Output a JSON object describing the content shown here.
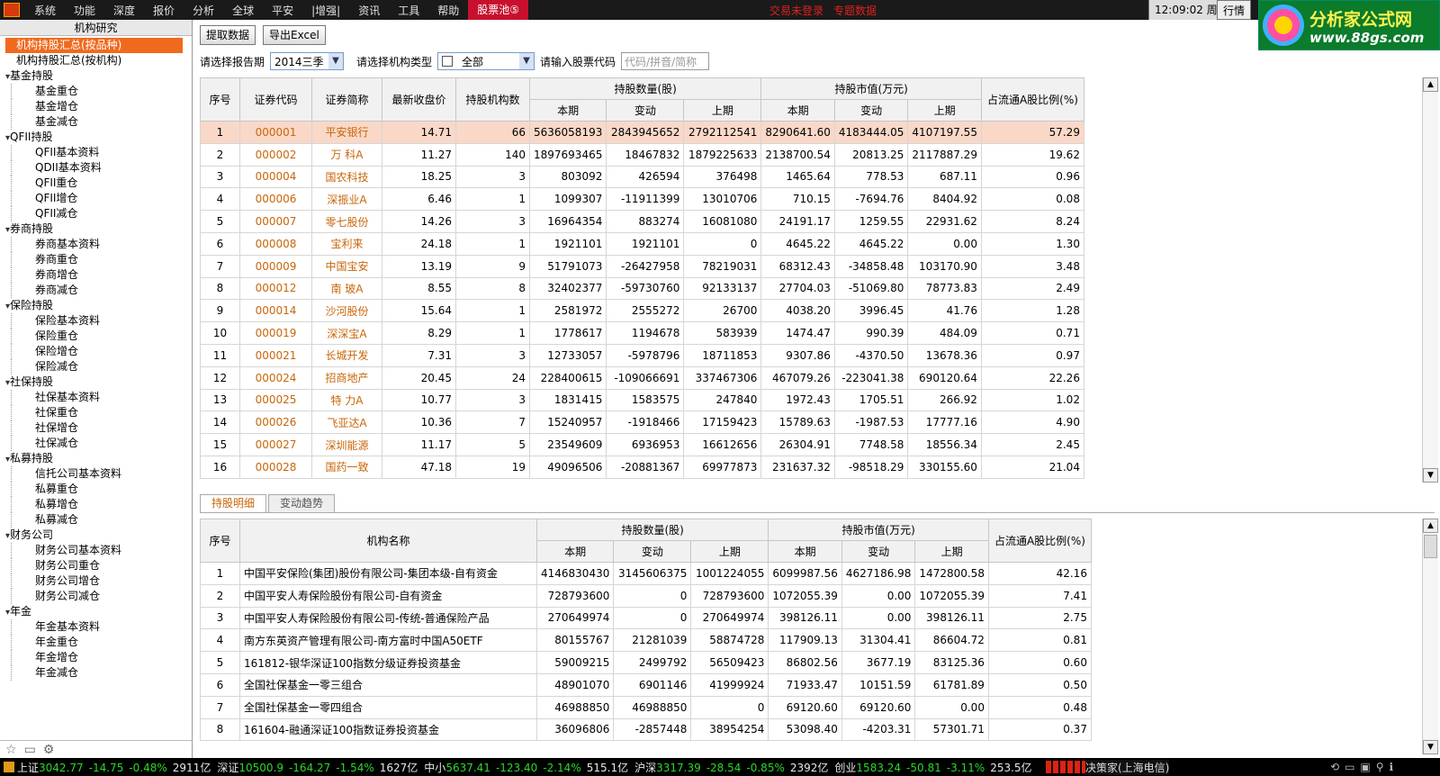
{
  "menu": {
    "items": [
      "系统",
      "功能",
      "深度",
      "报价",
      "分析",
      "全球",
      "平安",
      "|增强|",
      "资讯",
      "工具",
      "帮助"
    ],
    "active": "股票池⑤",
    "notice1": "交易未登录",
    "notice2": "专题数据",
    "clock": "12:09:02 周五",
    "hangqing": "行情"
  },
  "brand": {
    "title": "分析家公式网",
    "url": "www.88gs.com"
  },
  "sidebar": {
    "title": "机构研究",
    "items": [
      {
        "label": "机构持股汇总(按品种)",
        "type": "sel"
      },
      {
        "label": "机构持股汇总(按机构)",
        "type": "r"
      },
      {
        "label": "基金持股",
        "type": "g"
      },
      {
        "label": "基金重仓",
        "type": "c"
      },
      {
        "label": "基金增仓",
        "type": "c"
      },
      {
        "label": "基金减仓",
        "type": "c"
      },
      {
        "label": "QFII持股",
        "type": "g"
      },
      {
        "label": "QFII基本资料",
        "type": "c"
      },
      {
        "label": "QDII基本资料",
        "type": "c"
      },
      {
        "label": "QFII重仓",
        "type": "c"
      },
      {
        "label": "QFII增仓",
        "type": "c"
      },
      {
        "label": "QFII减仓",
        "type": "c"
      },
      {
        "label": "券商持股",
        "type": "g"
      },
      {
        "label": "券商基本资料",
        "type": "c"
      },
      {
        "label": "券商重仓",
        "type": "c"
      },
      {
        "label": "券商增仓",
        "type": "c"
      },
      {
        "label": "券商减仓",
        "type": "c"
      },
      {
        "label": "保险持股",
        "type": "g"
      },
      {
        "label": "保险基本资料",
        "type": "c"
      },
      {
        "label": "保险重仓",
        "type": "c"
      },
      {
        "label": "保险增仓",
        "type": "c"
      },
      {
        "label": "保险减仓",
        "type": "c"
      },
      {
        "label": "社保持股",
        "type": "g"
      },
      {
        "label": "社保基本资料",
        "type": "c"
      },
      {
        "label": "社保重仓",
        "type": "c"
      },
      {
        "label": "社保增仓",
        "type": "c"
      },
      {
        "label": "社保减仓",
        "type": "c"
      },
      {
        "label": "私募持股",
        "type": "g"
      },
      {
        "label": "信托公司基本资料",
        "type": "c"
      },
      {
        "label": "私募重仓",
        "type": "c"
      },
      {
        "label": "私募增仓",
        "type": "c"
      },
      {
        "label": "私募减仓",
        "type": "c"
      },
      {
        "label": "财务公司",
        "type": "g"
      },
      {
        "label": "财务公司基本资料",
        "type": "c"
      },
      {
        "label": "财务公司重仓",
        "type": "c"
      },
      {
        "label": "财务公司增仓",
        "type": "c"
      },
      {
        "label": "财务公司减仓",
        "type": "c"
      },
      {
        "label": "年金",
        "type": "g"
      },
      {
        "label": "年金基本资料",
        "type": "c"
      },
      {
        "label": "年金重仓",
        "type": "c"
      },
      {
        "label": "年金增仓",
        "type": "c"
      },
      {
        "label": "年金减仓",
        "type": "c"
      }
    ]
  },
  "toolbar": {
    "fetch": "提取数据",
    "export": "导出Excel"
  },
  "filters": {
    "period_label": "请选择报告期",
    "period_value": "2014三季",
    "type_label": "请选择机构类型",
    "type_value": "全部",
    "code_label": "请输入股票代码",
    "code_placeholder": "代码/拼音/简称"
  },
  "table1": {
    "h": {
      "seq": "序号",
      "code": "证券代码",
      "name": "证券简称",
      "close": "最新收盘价",
      "orgs": "持股机构数",
      "qty": "持股数量(股)",
      "val": "持股市值(万元)",
      "ratio": "占流通A股比例(%)",
      "cur": "本期",
      "chg": "变动",
      "prev": "上期"
    },
    "rows": [
      [
        "1",
        "000001",
        "平安银行",
        "14.71",
        "66",
        "5636058193",
        "2843945652",
        "2792112541",
        "8290641.60",
        "4183444.05",
        "4107197.55",
        "57.29"
      ],
      [
        "2",
        "000002",
        "万 科A",
        "11.27",
        "140",
        "1897693465",
        "18467832",
        "1879225633",
        "2138700.54",
        "20813.25",
        "2117887.29",
        "19.62"
      ],
      [
        "3",
        "000004",
        "国农科技",
        "18.25",
        "3",
        "803092",
        "426594",
        "376498",
        "1465.64",
        "778.53",
        "687.11",
        "0.96"
      ],
      [
        "4",
        "000006",
        "深振业A",
        "6.46",
        "1",
        "1099307",
        "-11911399",
        "13010706",
        "710.15",
        "-7694.76",
        "8404.92",
        "0.08"
      ],
      [
        "5",
        "000007",
        "零七股份",
        "14.26",
        "3",
        "16964354",
        "883274",
        "16081080",
        "24191.17",
        "1259.55",
        "22931.62",
        "8.24"
      ],
      [
        "6",
        "000008",
        "宝利来",
        "24.18",
        "1",
        "1921101",
        "1921101",
        "0",
        "4645.22",
        "4645.22",
        "0.00",
        "1.30"
      ],
      [
        "7",
        "000009",
        "中国宝安",
        "13.19",
        "9",
        "51791073",
        "-26427958",
        "78219031",
        "68312.43",
        "-34858.48",
        "103170.90",
        "3.48"
      ],
      [
        "8",
        "000012",
        "南 玻A",
        "8.55",
        "8",
        "32402377",
        "-59730760",
        "92133137",
        "27704.03",
        "-51069.80",
        "78773.83",
        "2.49"
      ],
      [
        "9",
        "000014",
        "沙河股份",
        "15.64",
        "1",
        "2581972",
        "2555272",
        "26700",
        "4038.20",
        "3996.45",
        "41.76",
        "1.28"
      ],
      [
        "10",
        "000019",
        "深深宝A",
        "8.29",
        "1",
        "1778617",
        "1194678",
        "583939",
        "1474.47",
        "990.39",
        "484.09",
        "0.71"
      ],
      [
        "11",
        "000021",
        "长城开发",
        "7.31",
        "3",
        "12733057",
        "-5978796",
        "18711853",
        "9307.86",
        "-4370.50",
        "13678.36",
        "0.97"
      ],
      [
        "12",
        "000024",
        "招商地产",
        "20.45",
        "24",
        "228400615",
        "-109066691",
        "337467306",
        "467079.26",
        "-223041.38",
        "690120.64",
        "22.26"
      ],
      [
        "13",
        "000025",
        "特 力A",
        "10.77",
        "3",
        "1831415",
        "1583575",
        "247840",
        "1972.43",
        "1705.51",
        "266.92",
        "1.02"
      ],
      [
        "14",
        "000026",
        "飞亚达A",
        "10.36",
        "7",
        "15240957",
        "-1918466",
        "17159423",
        "15789.63",
        "-1987.53",
        "17777.16",
        "4.90"
      ],
      [
        "15",
        "000027",
        "深圳能源",
        "11.17",
        "5",
        "23549609",
        "6936953",
        "16612656",
        "26304.91",
        "7748.58",
        "18556.34",
        "2.45"
      ],
      [
        "16",
        "000028",
        "国药一致",
        "47.18",
        "19",
        "49096506",
        "-20881367",
        "69977873",
        "231637.32",
        "-98518.29",
        "330155.60",
        "21.04"
      ]
    ]
  },
  "tabs": [
    "持股明细",
    "变动趋势"
  ],
  "table2": {
    "h": {
      "seq": "序号",
      "org": "机构名称",
      "qty": "持股数量(股)",
      "val": "持股市值(万元)",
      "ratio": "占流通A股比例(%)",
      "cur": "本期",
      "chg": "变动",
      "prev": "上期"
    },
    "rows": [
      [
        "1",
        "中国平安保险(集团)股份有限公司-集团本级-自有资金",
        "4146830430",
        "3145606375",
        "1001224055",
        "6099987.56",
        "4627186.98",
        "1472800.58",
        "42.16"
      ],
      [
        "2",
        "中国平安人寿保险股份有限公司-自有资金",
        "728793600",
        "0",
        "728793600",
        "1072055.39",
        "0.00",
        "1072055.39",
        "7.41"
      ],
      [
        "3",
        "中国平安人寿保险股份有限公司-传统-普通保险产品",
        "270649974",
        "0",
        "270649974",
        "398126.11",
        "0.00",
        "398126.11",
        "2.75"
      ],
      [
        "4",
        "南方东英资产管理有限公司-南方富时中国A50ETF",
        "80155767",
        "21281039",
        "58874728",
        "117909.13",
        "31304.41",
        "86604.72",
        "0.81"
      ],
      [
        "5",
        "161812-银华深证100指数分级证券投资基金",
        "59009215",
        "2499792",
        "56509423",
        "86802.56",
        "3677.19",
        "83125.36",
        "0.60"
      ],
      [
        "6",
        "全国社保基金一零三组合",
        "48901070",
        "6901146",
        "41999924",
        "71933.47",
        "10151.59",
        "61781.89",
        "0.50"
      ],
      [
        "7",
        "全国社保基金一零四组合",
        "46988850",
        "46988850",
        "0",
        "69120.60",
        "69120.60",
        "0.00",
        "0.48"
      ],
      [
        "8",
        "161604-融通深证100指数证券投资基金",
        "36096806",
        "-2857448",
        "38954254",
        "53098.40",
        "-4203.31",
        "57301.71",
        "0.37"
      ]
    ]
  },
  "status": {
    "idx": [
      {
        "name": "上证",
        "val": "3042.77",
        "chg": "-14.75",
        "pct": "-0.48%",
        "amt": "2911亿"
      },
      {
        "name": "深证",
        "val": "10500.9",
        "chg": "-164.27",
        "pct": "-1.54%",
        "amt": "1627亿"
      },
      {
        "name": "中小",
        "val": "5637.41",
        "chg": "-123.40",
        "pct": "-2.14%",
        "amt": "515.1亿"
      },
      {
        "name": "沪深",
        "val": "3317.39",
        "chg": "-28.54",
        "pct": "-0.85%",
        "amt": "2392亿"
      },
      {
        "name": "创业",
        "val": "1583.24",
        "chg": "-50.81",
        "pct": "-3.11%",
        "amt": "253.5亿"
      }
    ],
    "server": "决策家(上海电信)"
  }
}
